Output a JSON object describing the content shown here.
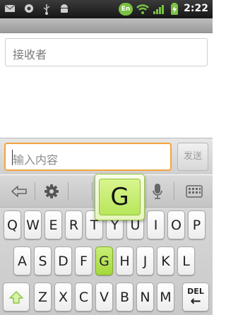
{
  "status_bar": {
    "time": "2:22",
    "input_badge": "En",
    "left_icons": [
      "envelope-icon",
      "record-icon",
      "usb-icon",
      "android-icon"
    ],
    "right_icons": [
      "wifi-icon",
      "signal-icon",
      "battery-charging-icon"
    ],
    "accent_color": "#7ac143"
  },
  "recipient": {
    "placeholder": "接收者"
  },
  "compose": {
    "placeholder": "输入内容",
    "send_label": "发送",
    "focus_color": "#f2a43d"
  },
  "keyboard": {
    "toolbar_icons": [
      "collapse-keyboard-icon",
      "gear-icon",
      "microphone-icon",
      "keyboard-layout-icon"
    ],
    "rows": [
      [
        "Q",
        "W",
        "E",
        "R",
        "T",
        "Y",
        "U",
        "I",
        "O",
        "P"
      ],
      [
        "A",
        "S",
        "D",
        "F",
        "G",
        "H",
        "J",
        "K",
        "L"
      ],
      [
        "Z",
        "X",
        "C",
        "V",
        "B",
        "N",
        "M"
      ]
    ],
    "delete_label": "DEL",
    "pressed_key": "G",
    "highlight_color": "#b7e65a"
  }
}
